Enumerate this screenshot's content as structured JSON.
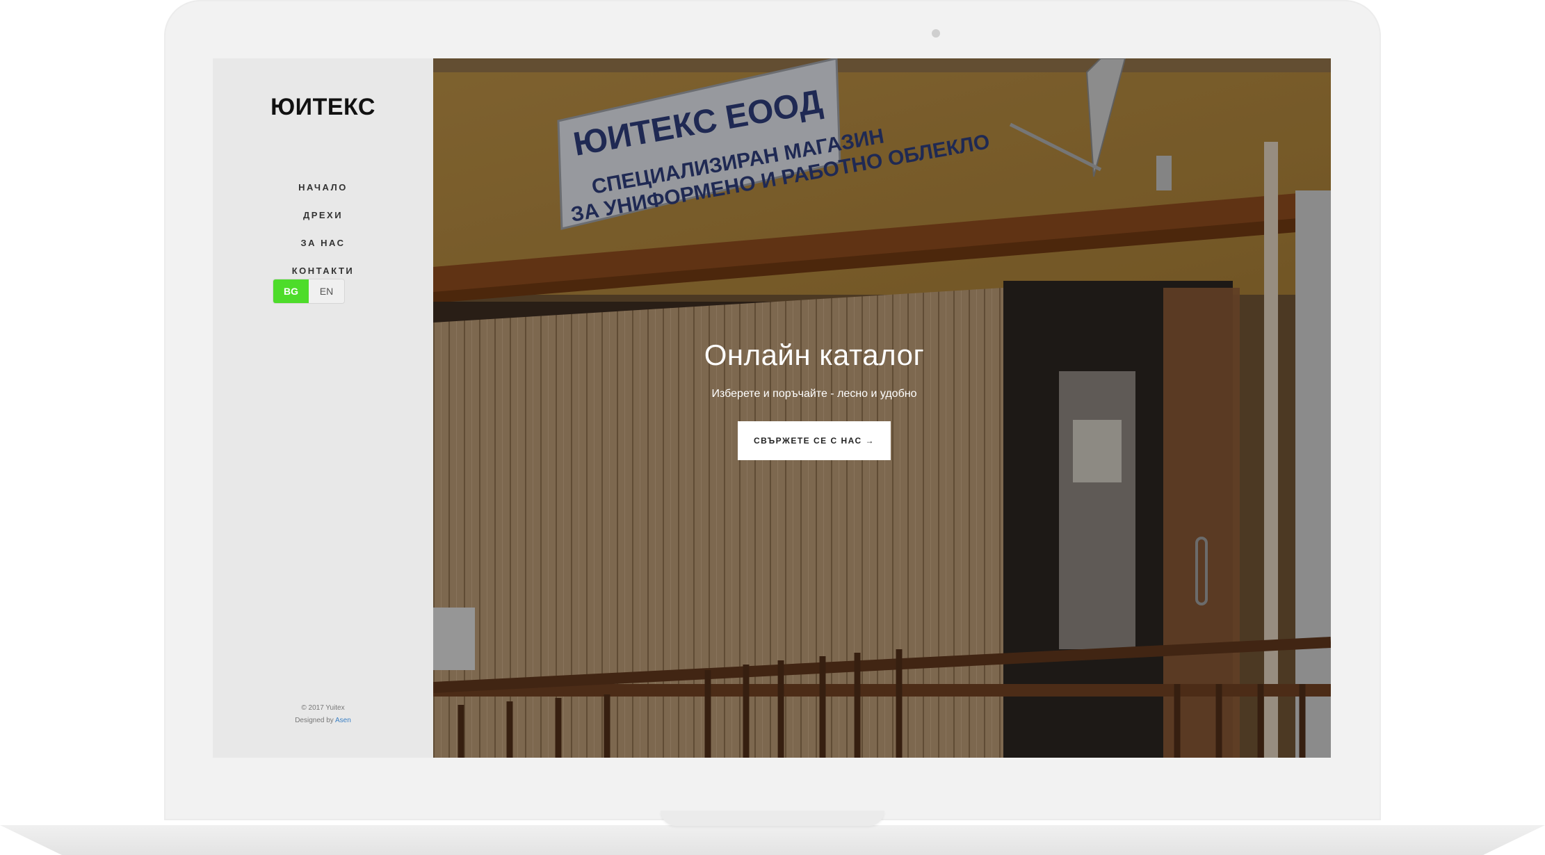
{
  "brand": {
    "name": "ЮИТЕКС"
  },
  "nav": {
    "items": [
      "НАЧАЛО",
      "ДРЕХИ",
      "ЗА НАС",
      "КОНТАКТИ"
    ]
  },
  "language": {
    "options": [
      "BG",
      "EN"
    ],
    "selected": "BG"
  },
  "hero": {
    "title": "Онлайн каталог",
    "subtitle": "Изберете и поръчайте - лесно и удобно",
    "cta_label": "СВЪРЖЕТЕ СЕ С НАС →",
    "sign": {
      "line1": "ЮИТЕКС ЕООД",
      "line2": "СПЕЦИАЛИЗИРАН МАГАЗИН",
      "line3": "ЗА УНИФОРМЕНО И РАБОТНО ОБЛЕКЛО"
    }
  },
  "footer": {
    "copyright": "© 2017 Yuitex",
    "designed_by": "Designed by",
    "designer": "Asen"
  },
  "colors": {
    "accent": "#4ddc2a",
    "link": "#3a7fc4",
    "sidebar_bg": "#e8e8e8"
  }
}
